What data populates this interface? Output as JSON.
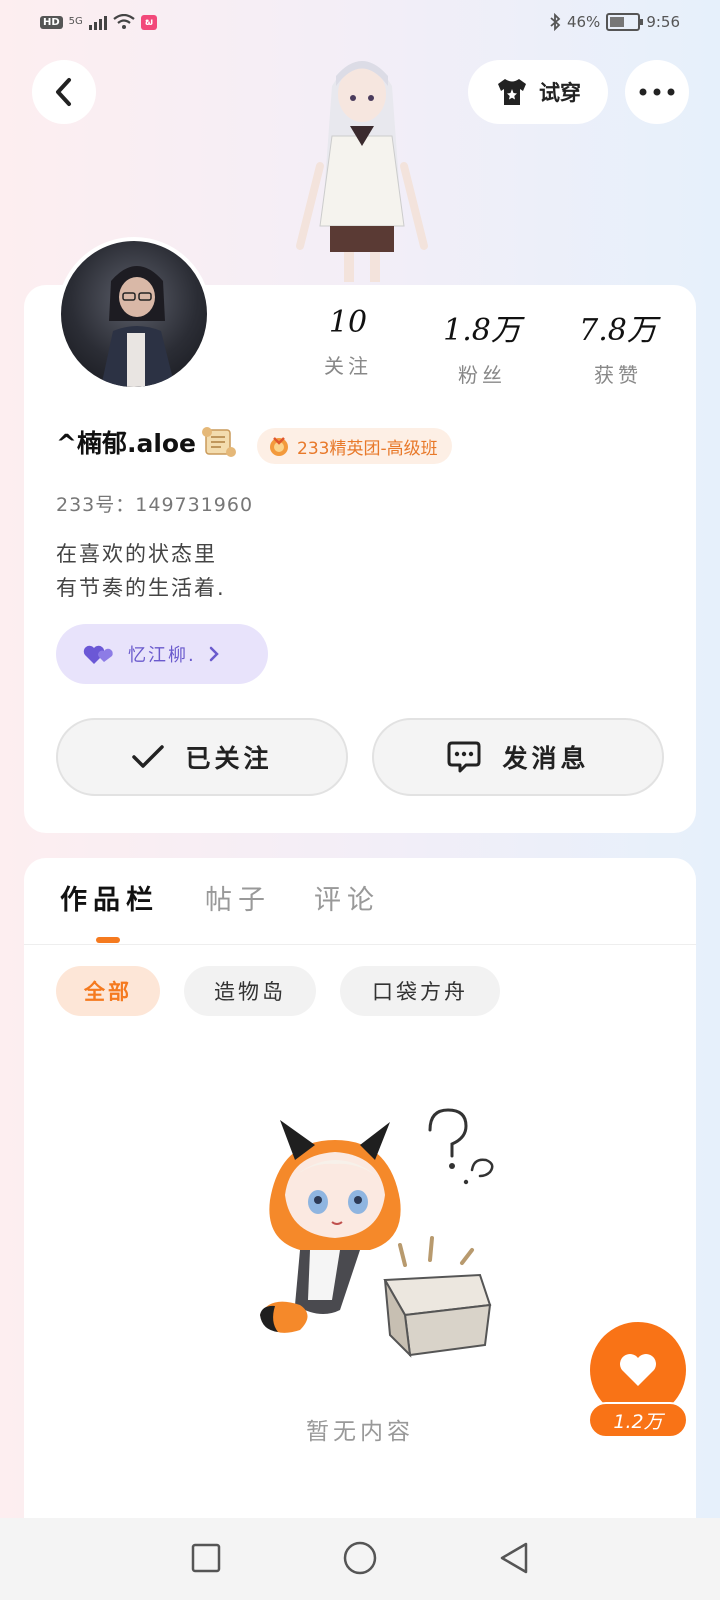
{
  "status_bar": {
    "hd": "HD",
    "network": "5G",
    "battery_percent": "46%",
    "time": "9:56"
  },
  "header": {
    "tryon_label": "试穿"
  },
  "profile": {
    "stats": [
      {
        "value": "10",
        "label": "关注"
      },
      {
        "value": "1.8万",
        "label": "粉丝"
      },
      {
        "value": "7.8万",
        "label": "获赞"
      }
    ],
    "nickname": "^楠郁.aloe",
    "badge": "233精英团-高级班",
    "uid": "233号：149731960",
    "bio_line1": "在喜欢的状态里",
    "bio_line2": "有节奏的生活着.",
    "cp_name": "忆江柳.",
    "follow_label": "已关注",
    "message_label": "发消息"
  },
  "works": {
    "tabs": [
      {
        "label": "作品栏",
        "active": true
      },
      {
        "label": "帖子",
        "active": false
      },
      {
        "label": "评论",
        "active": false
      }
    ],
    "filters": [
      {
        "label": "全部",
        "active": true
      },
      {
        "label": "造物岛",
        "active": false
      },
      {
        "label": "口袋方舟",
        "active": false
      }
    ],
    "empty_text": "暂无内容"
  },
  "like": {
    "count": "1.2万"
  },
  "colors": {
    "accent": "#f57a1f",
    "like_button": "#f97316",
    "cp_chip": "#e8e3fb"
  }
}
